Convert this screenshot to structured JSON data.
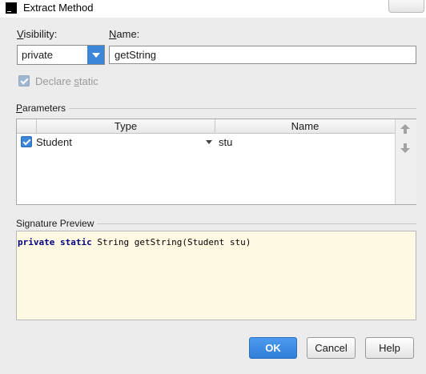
{
  "window": {
    "title": "Extract Method",
    "app_icon": "intellij-icon"
  },
  "visibility": {
    "label_prefix": "",
    "label_mnemonic": "V",
    "label_rest": "isibility:",
    "selected": "private"
  },
  "name": {
    "label_mnemonic": "N",
    "label_rest": "ame:",
    "value": "getString"
  },
  "declare_static": {
    "label_before": "Declare ",
    "label_mnemonic": "s",
    "label_after": "tatic",
    "checked": true,
    "enabled": false
  },
  "parameters": {
    "title_mnemonic": "P",
    "title_rest": "arameters",
    "columns": [
      "Type",
      "Name"
    ],
    "rows": [
      {
        "checked": true,
        "type": "Student",
        "name": "stu"
      }
    ]
  },
  "signature_preview": {
    "title": "Signature Preview",
    "kw1": "private",
    "kw2": "static",
    "rest": " String getString(Student stu)"
  },
  "buttons": {
    "ok": "OK",
    "cancel": "Cancel",
    "help": "Help"
  },
  "colors": {
    "accent": "#3b86d8",
    "preview_bg": "#fdf9e2",
    "keyword": "#000080"
  }
}
